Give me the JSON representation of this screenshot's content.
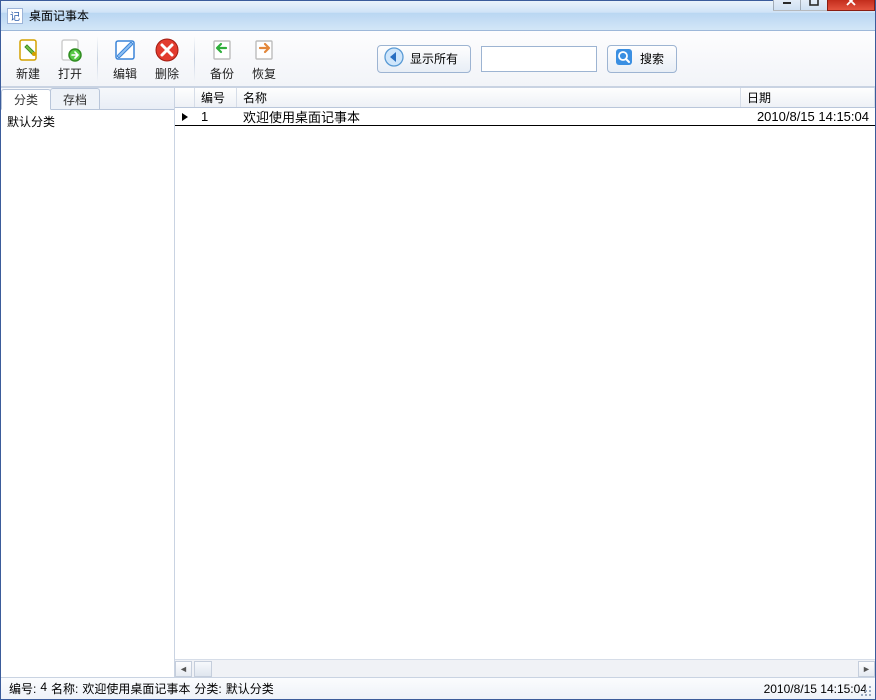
{
  "window": {
    "title": "桌面记事本",
    "icon_text": "记"
  },
  "toolbar": {
    "new_label": "新建",
    "open_label": "打开",
    "edit_label": "编辑",
    "delete_label": "删除",
    "backup_label": "备份",
    "restore_label": "恢复",
    "show_all_label": "显示所有",
    "search_label": "搜索",
    "search_value": ""
  },
  "sidebar": {
    "tabs": [
      {
        "label": "分类",
        "active": true
      },
      {
        "label": "存档",
        "active": false
      }
    ],
    "categories": [
      {
        "label": "默认分类"
      }
    ]
  },
  "columns": {
    "id": "编号",
    "name": "名称",
    "date": "日期"
  },
  "rows": [
    {
      "id": "1",
      "name": "欢迎使用桌面记事本",
      "date": "2010/8/15 14:15:04",
      "selected": true
    }
  ],
  "status": {
    "id_label": "编号:",
    "id_value": "4",
    "name_label": "名称:",
    "name_value": "欢迎使用桌面记事本",
    "cat_label": "分类:",
    "cat_value": "默认分类",
    "date": "2010/8/15 14:15:04"
  }
}
